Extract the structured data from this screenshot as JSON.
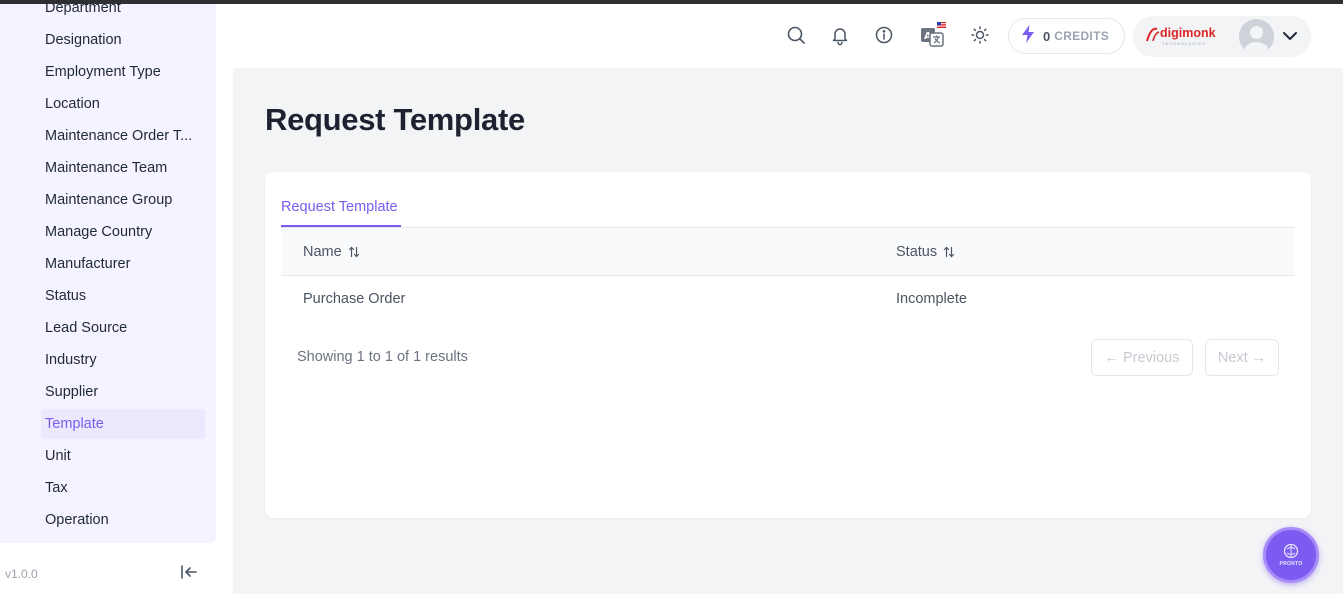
{
  "sidebar": {
    "items": [
      {
        "label": "Department"
      },
      {
        "label": "Designation"
      },
      {
        "label": "Employment Type"
      },
      {
        "label": "Location"
      },
      {
        "label": "Maintenance Order T..."
      },
      {
        "label": "Maintenance Team"
      },
      {
        "label": "Maintenance Group"
      },
      {
        "label": "Manage Country"
      },
      {
        "label": "Manufacturer"
      },
      {
        "label": "Status"
      },
      {
        "label": "Lead Source"
      },
      {
        "label": "Industry"
      },
      {
        "label": "Supplier"
      },
      {
        "label": "Template",
        "active": true
      },
      {
        "label": "Unit"
      },
      {
        "label": "Tax"
      },
      {
        "label": "Operation"
      }
    ],
    "version": "v1.0.0"
  },
  "header": {
    "icons": [
      "search-icon",
      "bell-icon",
      "info-icon",
      "translate-icon",
      "sun-icon"
    ],
    "credits": {
      "count": "0",
      "label": "CREDITS"
    },
    "logo_text": "digimonk",
    "logo_subtext": "TECHNOLOGIES",
    "accent": "#7c5cf0"
  },
  "main": {
    "page_title": "Request Template",
    "tab": "Request Template",
    "table": {
      "columns": [
        "Name",
        "Status"
      ],
      "rows": [
        {
          "name": "Purchase Order",
          "status": "Incomplete"
        }
      ]
    },
    "pagination": {
      "summary": "Showing 1 to 1 of 1 results",
      "previous": "← Previous",
      "next": "Next →"
    }
  },
  "fab": {
    "label": "PRONTO"
  }
}
